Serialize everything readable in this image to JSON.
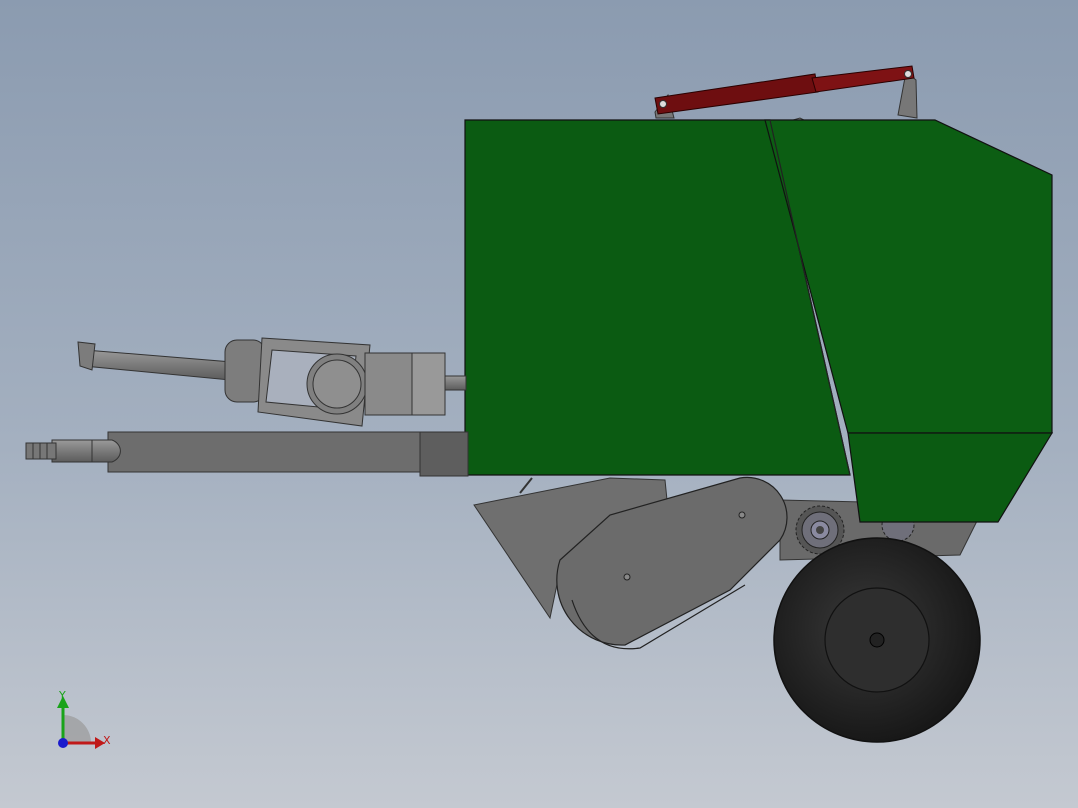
{
  "viewport": {
    "background_top": "#8b9bb0",
    "background_bottom": "#c4c9d1"
  },
  "model": {
    "body_color": "#0b5b12",
    "cylinder_color": "#6e0e10",
    "frame_color": "#6a6a6a",
    "tire_color": "#262626"
  },
  "triad": {
    "y_label": "Y",
    "x_label": "X",
    "y_color": "#19a319",
    "x_color": "#c01919",
    "z_color": "#1a1acc"
  }
}
